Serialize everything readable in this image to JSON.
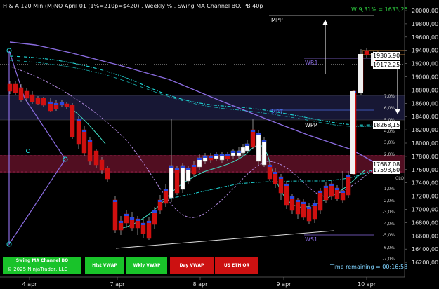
{
  "header": {
    "title": "H & A 120 Min  (M)NQ April 01 (1%=210p=$420) , Weekly % , Swing MA Channel BO, PB 40p"
  },
  "badge": {
    "text": "W 9,31% = 1633,25"
  },
  "price_axis": {
    "labels": [
      "20000,00",
      "19800,00",
      "19600,00",
      "19400,00",
      "19200,00",
      "19000,00",
      "18800,00",
      "18600,00",
      "18400,00",
      "18200,00",
      "18000,00",
      "17800,00",
      "17600,00",
      "17400,00",
      "17200,00",
      "17000,00",
      "16800,00",
      "16600,00",
      "16400,00",
      "16200,00"
    ],
    "price_tags": [
      "19305,90",
      "19172,25",
      "18268,15",
      "17687,08",
      "17593,60"
    ]
  },
  "percent_labels": [
    "7,0%",
    "6,0%",
    "5,0%",
    "4,0%",
    "3,0%",
    "2,0%",
    "1,0%",
    "-1,0%",
    "-2,0%",
    "-3,0%",
    "-4,0%",
    "-5,0%",
    "-6,0%",
    "-7,0%"
  ],
  "level_labels": {
    "mpp": "MPP",
    "wr1": "WR1",
    "mpt": "MPT",
    "wpp": "WPP",
    "clo": "CLO",
    "ws1": "WS1"
  },
  "time_axis": {
    "labels": [
      "4 apr",
      "7 apr",
      "8 apr",
      "9 apr",
      "10 apr"
    ]
  },
  "buttons": [
    {
      "label": "Swing MA Channel BO",
      "color": "#19c32a"
    },
    {
      "label": "Hist VWAP",
      "color": "#19c32a"
    },
    {
      "label": "Wkly VWAP",
      "color": "#19c32a"
    },
    {
      "label": "Day VWAP",
      "color": "#cc1111"
    },
    {
      "label": "US ETH OR",
      "color": "#cc1111"
    }
  ],
  "footer": {
    "copyright": "© 2025 NinjaTrader, LLC",
    "time_remaining": "Time remaining = 00:16:58"
  },
  "colors": {
    "bull": "#ffffff",
    "bear": "#d01010",
    "ma_cyan": "#20d8d8",
    "trend_purple": "#8a6ce0",
    "band_red": "#5a1025",
    "band_blue": "#1a1a3a"
  }
}
